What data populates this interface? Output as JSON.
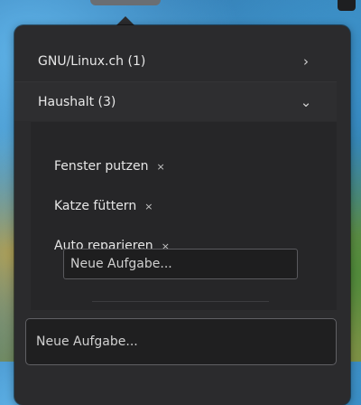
{
  "groups": [
    {
      "label": "GNU/Linux.ch (1)",
      "icon": "chevron-right-icon",
      "expanded": false
    },
    {
      "label": "Haushalt (3)",
      "icon": "chevron-down-icon",
      "expanded": true
    }
  ],
  "tasks": [
    {
      "label": "Fenster putzen",
      "remove_glyph": "×"
    },
    {
      "label": "Katze füttern",
      "remove_glyph": "×"
    },
    {
      "label": "Auto reparieren",
      "remove_glyph": "×"
    }
  ],
  "group_new_task": {
    "placeholder": "Neue Aufgabe..."
  },
  "new_task": {
    "placeholder": "Neue Aufgabe..."
  },
  "colors": {
    "popover_bg": "#2b2b2d",
    "text": "#e8e8e8"
  }
}
